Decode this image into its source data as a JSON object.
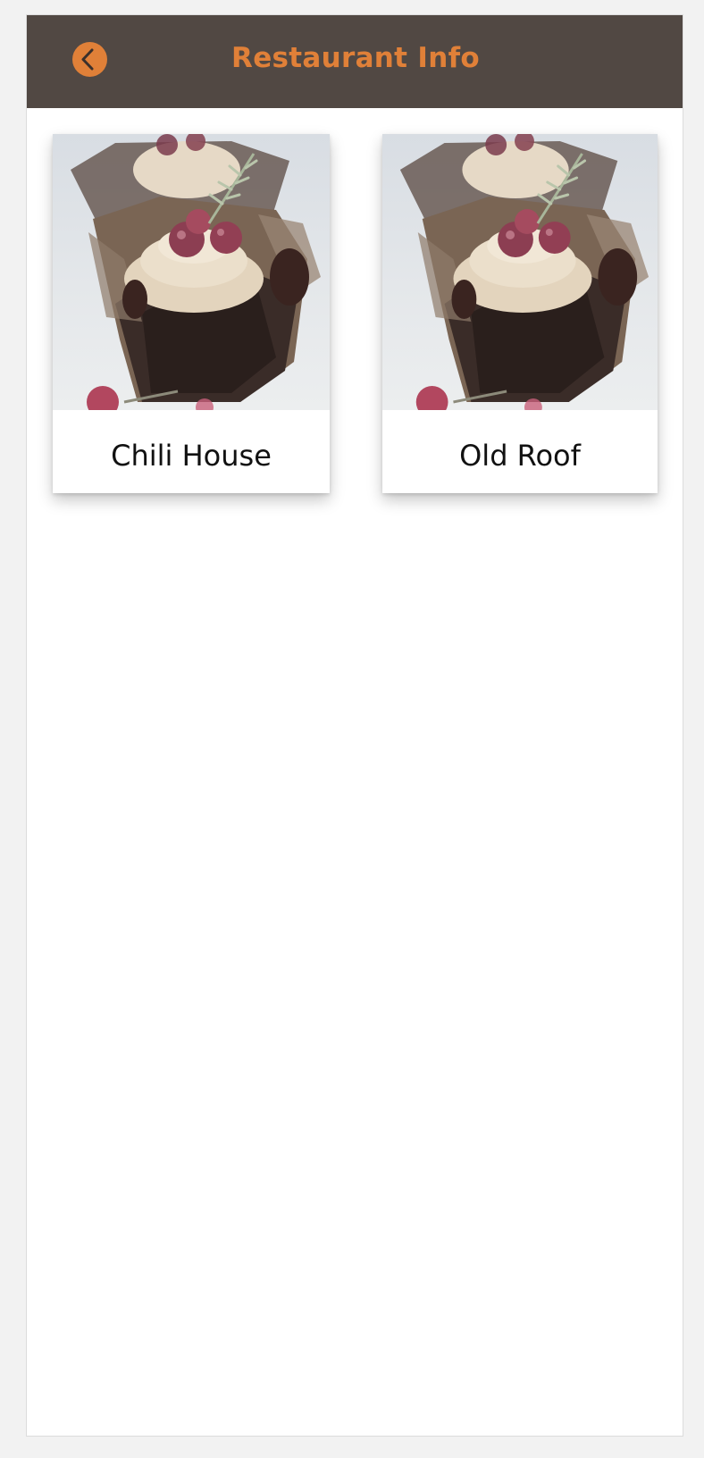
{
  "header": {
    "title": "Restaurant Info",
    "back_icon": "chevron-left-icon",
    "bg_color": "#514843",
    "accent_color": "#e08038"
  },
  "restaurants": [
    {
      "name": "Chili House",
      "image": "cupcake-photo"
    },
    {
      "name": "Old Roof",
      "image": "cupcake-photo"
    }
  ]
}
